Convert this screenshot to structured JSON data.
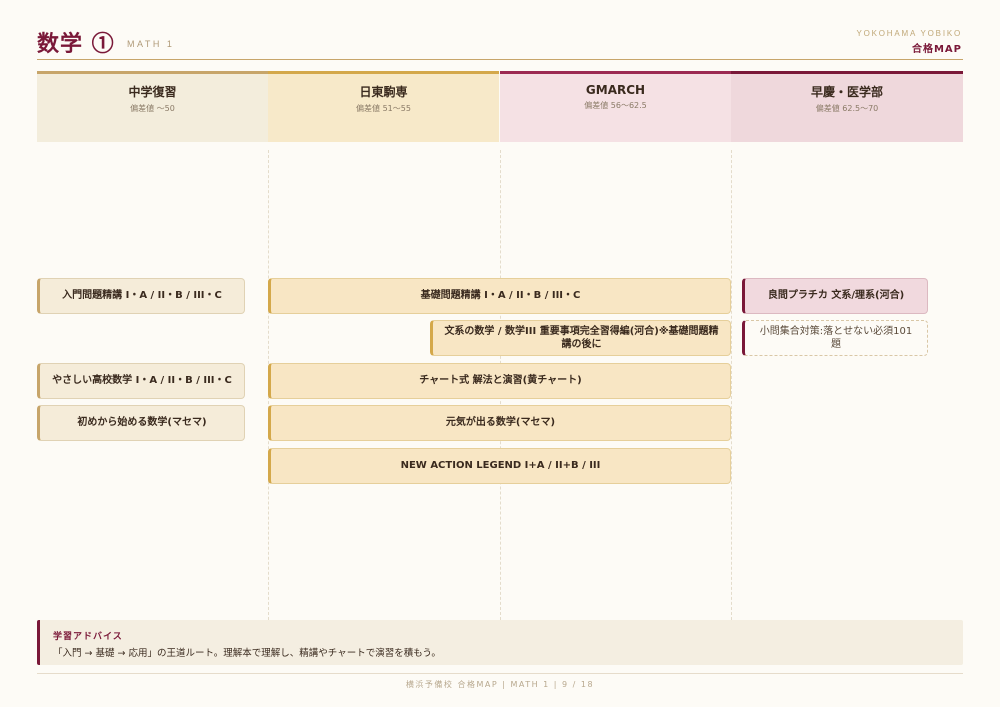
{
  "header": {
    "title": "数学 ①",
    "subtitle": "MATH 1",
    "brand": "YOKOHAMA YOBIKO",
    "brand_sub": "合格MAP"
  },
  "columns": [
    {
      "name": "中学復習",
      "deviation": "偏差値 〜50"
    },
    {
      "name": "日東駒専",
      "deviation": "偏差値 51〜55"
    },
    {
      "name": "GMARCH",
      "deviation": "偏差値 56〜62.5"
    },
    {
      "name": "早慶・医学部",
      "deviation": "偏差値 62.5〜70"
    }
  ],
  "books": {
    "nyumon": "入門問題精講 I・A / II・B / III・C",
    "kiso": "基礎問題精講 I・A / II・B / III・C",
    "bunkei": "文系の数学 / 数学III 重要事項完全習得編(河合)※基礎問題精講の後に",
    "ryomon": "良問プラチカ 文系/理系(河合)",
    "shomon": "小問集合対策:落とせない必須101題",
    "yasashii": "やさしい高校数学 I・A / II・B / III・C",
    "chart": "チャート式 解法と演習(黄チャート)",
    "hajimekara": "初めから始める数学(マセマ)",
    "genki": "元気が出る数学(マセマ)",
    "newaction": "NEW ACTION LEGEND I+A / II+B / III"
  },
  "advice": {
    "label": "学習アドバイス",
    "text": "「入門 → 基礎 → 応用」の王道ルート。理解本で理解し、精講やチャートで演習を積もう。"
  },
  "footer": "横浜予備校 合格MAP | MATH 1 | 9 / 18"
}
